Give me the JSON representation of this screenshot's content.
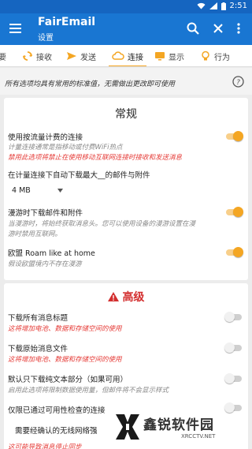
{
  "status_bar": {
    "time": "2:51"
  },
  "app_bar": {
    "title": "FairEmail",
    "subtitle": "设置"
  },
  "tabs": [
    {
      "label": "要",
      "icon": "none"
    },
    {
      "label": "接收",
      "icon": "sync-icon"
    },
    {
      "label": "发送",
      "icon": "send-icon"
    },
    {
      "label": "连接",
      "icon": "cloud-icon",
      "active": true
    },
    {
      "label": "显示",
      "icon": "monitor-icon"
    },
    {
      "label": "行为",
      "icon": "lightbulb-icon"
    }
  ],
  "hint": {
    "text": "所有选项均具有常用的标准值，无需做出更改即可使用"
  },
  "general": {
    "title": "常规",
    "metered": {
      "label": "使用按流量计费的连接",
      "description": "计量连接通常是指移动或付费WiFi热点",
      "warning": "禁用此选项将禁止在使用移动互联网连接时接收和发送消息",
      "enabled": true
    },
    "download_limit": {
      "label": "在计量连接下自动下载最大__的邮件与附件",
      "value": "4 MB"
    },
    "roaming": {
      "label": "漫游时下载邮件和附件",
      "description1": "当漫游时，将始终获取消息头。您可以使用设备的漫游设置在漫",
      "description2": "游时禁用互联网。",
      "enabled": true
    },
    "eu_roaming": {
      "label": "欧盟 Roam like at home",
      "description": "假设欧盟境内不存在漫游",
      "enabled": true
    }
  },
  "advanced": {
    "title": "高级",
    "download_headers": {
      "label": "下载所有消息标题",
      "warning": "这将增加电池、数据和存储空间的使用",
      "enabled": false
    },
    "download_eml": {
      "label": "下载原始消息文件",
      "warning": "这将增加电池、数据和存储空间的使用",
      "enabled": false
    },
    "download_plain": {
      "label": "默认只下载纯文本部分（如果可用）",
      "description": "启用此选项将限制数据使用量，但邮件将不会显示样式",
      "enabled": false
    },
    "validated": {
      "label": "仅限已通过可用性检查的连接",
      "enabled": false
    },
    "wifi_validated": {
      "label": "需要经确认的无线网络强"
    },
    "last_line": "这可能导致消息停止同步"
  },
  "watermark": {
    "brand": "鑫锐软件园",
    "site": "XRCCTV.NET"
  },
  "colors": {
    "primary": "#1976d2",
    "accent": "#f4a623",
    "warning": "#e53935"
  }
}
